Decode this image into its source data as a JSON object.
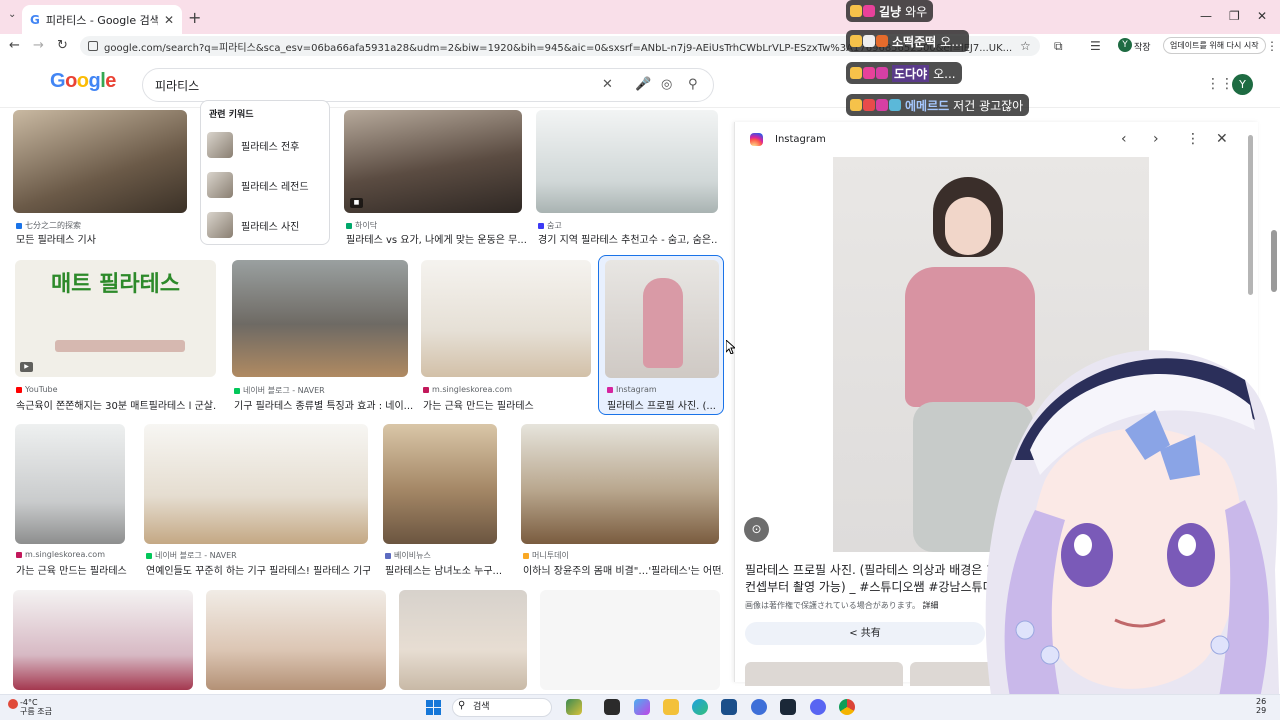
{
  "browser": {
    "tab_title": "피라티스 - Google 검색",
    "url": "google.com/search?q=피라티스&sca_esv=06ba66afa5931a28&udm=2&biw=1920&bih=945&aic=0&sxsrf=ANbL-n7j9-AEiUsTrhCWbLrVLP-ESzxTw%3A1769685652500&ei=lEJ7...UK...",
    "profile_label": "작장",
    "profile_initial": "Y",
    "update_label": "업데이트를 위해 다시 시작"
  },
  "google": {
    "logo": "Google",
    "query": "피라티스",
    "user_initial": "Y"
  },
  "related": {
    "title": "관련 키워드",
    "items": [
      "필라테스 전후",
      "필라테스 레전드",
      "필라테스 사진"
    ]
  },
  "results": [
    {
      "source": "七分之二的探索",
      "caption": "모든 필라테스 기사",
      "color": "#1a73e8"
    },
    {
      "source": "하이닥",
      "caption": "필라테스 vs 요가, 나에게 맞는 운동은 무...",
      "color": "#00a86b"
    },
    {
      "source": "숨고",
      "caption": "경기 지역 필라테스 추천고수 - 숨고, 숨은...",
      "color": "#3d3af5"
    },
    {
      "source": "YouTube",
      "caption": "속근육이 쫀쫀해지는 30분 매트필라테스 l 군살...",
      "color": "#ff0000"
    },
    {
      "source": "네이버 블로그 - NAVER",
      "caption": "기구 필라테스 종류별 특징과 효과 : 네이...",
      "color": "#03c75a"
    },
    {
      "source": "m.singleskorea.com",
      "caption": "가는 근육 만드는 필라테스",
      "color": "#c2185b"
    },
    {
      "source": "Instagram",
      "caption": "필라테스 프로필 사진. (...",
      "color": "#d6249f"
    },
    {
      "source": "m.singleskorea.com",
      "caption": "가는 근육 만드는 필라테스",
      "color": "#c2185b"
    },
    {
      "source": "네이버 블로그 - NAVER",
      "caption": "연예인들도 꾸준히 하는 기구 필라테스! 필라테스 기구...",
      "color": "#03c75a"
    },
    {
      "source": "베이비뉴스",
      "caption": "필라테스는 남녀노소 누구...",
      "color": "#5c6bc0"
    },
    {
      "source": "머니투데이",
      "caption": "이하늬 장윤주의 몸매 비결\"…'필라테스'는 어떤...",
      "color": "#f9a825"
    }
  ],
  "banner_text": "매트 필라테스",
  "panel": {
    "site": "Instagram",
    "caption": "필라테스 프로필 사진. (필라테스 의상과 배경은 1컨셉부터 촬영 가능) _ #스튜디오쌤 #강남스튜디",
    "copyright": "画像は著作権で保護されている場合があります。",
    "details": "詳細",
    "share": "共有"
  },
  "chat": [
    {
      "name": "길냥",
      "message": "와우",
      "name_color": "#ffffff"
    },
    {
      "name": "소떡준떡",
      "message": "오...",
      "name_color": "#ffffff"
    },
    {
      "name": "도다야",
      "message": "오...",
      "name_color": "#ffffff"
    },
    {
      "name": "에메르드",
      "message": "저건 광고잖아",
      "name_color": "#a6c8ff"
    }
  ],
  "taskbar": {
    "temp": "-4°C",
    "weather": "구름 조금",
    "search": "검색",
    "time": "26",
    "date": "29"
  }
}
